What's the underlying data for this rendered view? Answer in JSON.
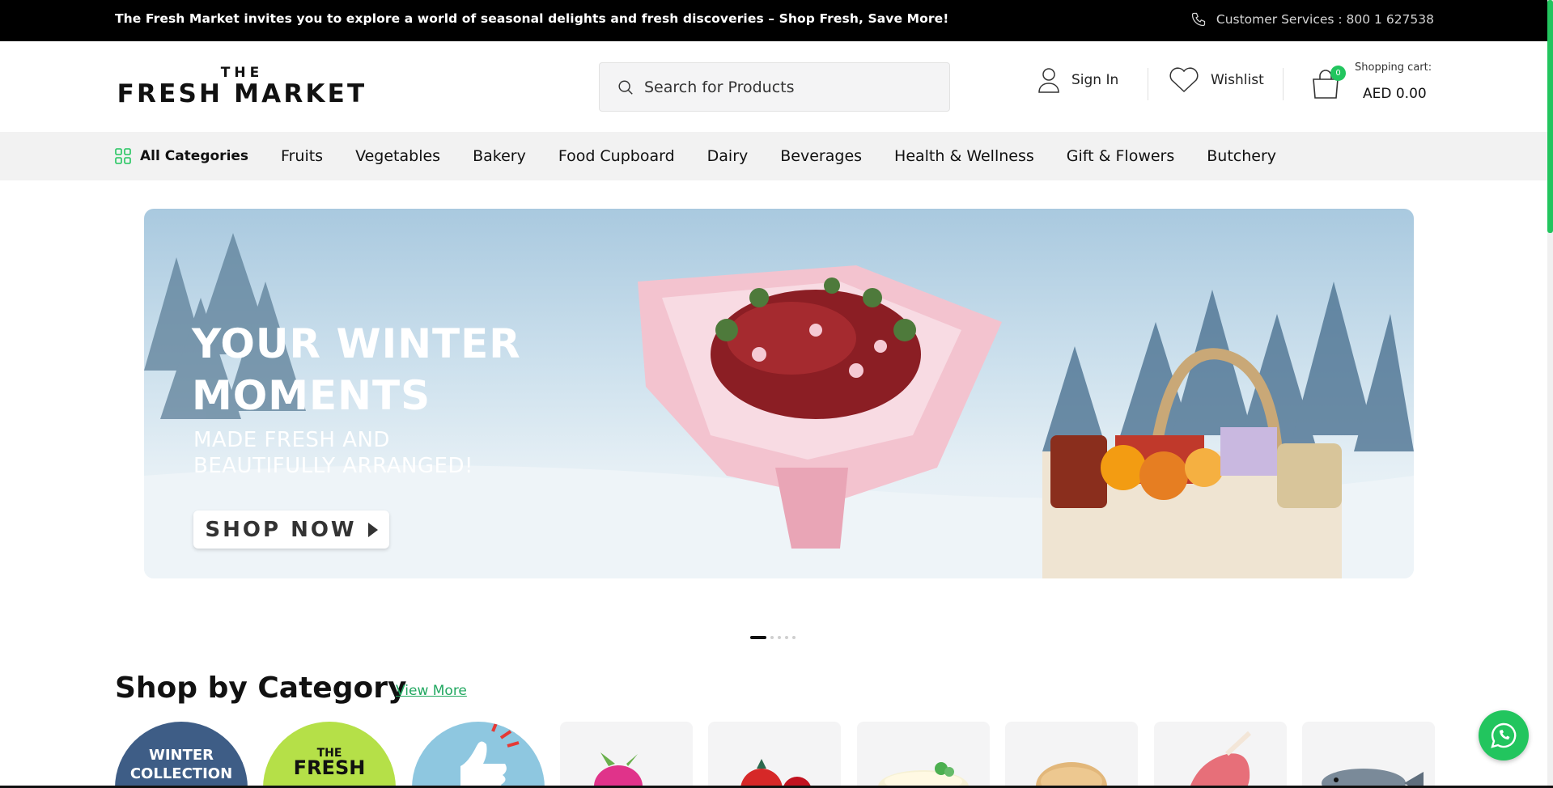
{
  "topbar": {
    "promo": "The Fresh Market invites you to explore a world of seasonal delights and fresh discoveries – Shop Fresh, Save More!",
    "customer_services": "Customer Services : 800 1 627538",
    "icon": "phone-icon"
  },
  "header": {
    "logo_the": "THE",
    "logo_main": "FRESH MARKET",
    "search_placeholder": "Search for Products",
    "sign_in": "Sign In",
    "wishlist": "Wishlist",
    "cart_label": "Shopping cart:",
    "cart_total": "AED 0.00",
    "cart_count": "0"
  },
  "nav": {
    "all_categories": "All Categories",
    "items": [
      "Fruits",
      "Vegetables",
      "Bakery",
      "Food Cupboard",
      "Dairy",
      "Beverages",
      "Health & Wellness",
      "Gift & Flowers",
      "Butchery"
    ]
  },
  "hero": {
    "headline": "YOUR WINTER MOMENTS",
    "subline": "MADE FRESH AND BEAUTIFULLY ARRANGED!",
    "cta": "SHOP NOW",
    "slide_count": 5,
    "active_slide": 1
  },
  "categories": {
    "title": "Shop by Category",
    "view_more": "View More",
    "winter_tile": "WINTER COLLECTION",
    "fresh_tile_the": "THE",
    "fresh_tile_main": "FRESH"
  },
  "colors": {
    "accent": "#22c55e",
    "topbar": "#000000",
    "nav_bg": "#f2f2f2"
  }
}
